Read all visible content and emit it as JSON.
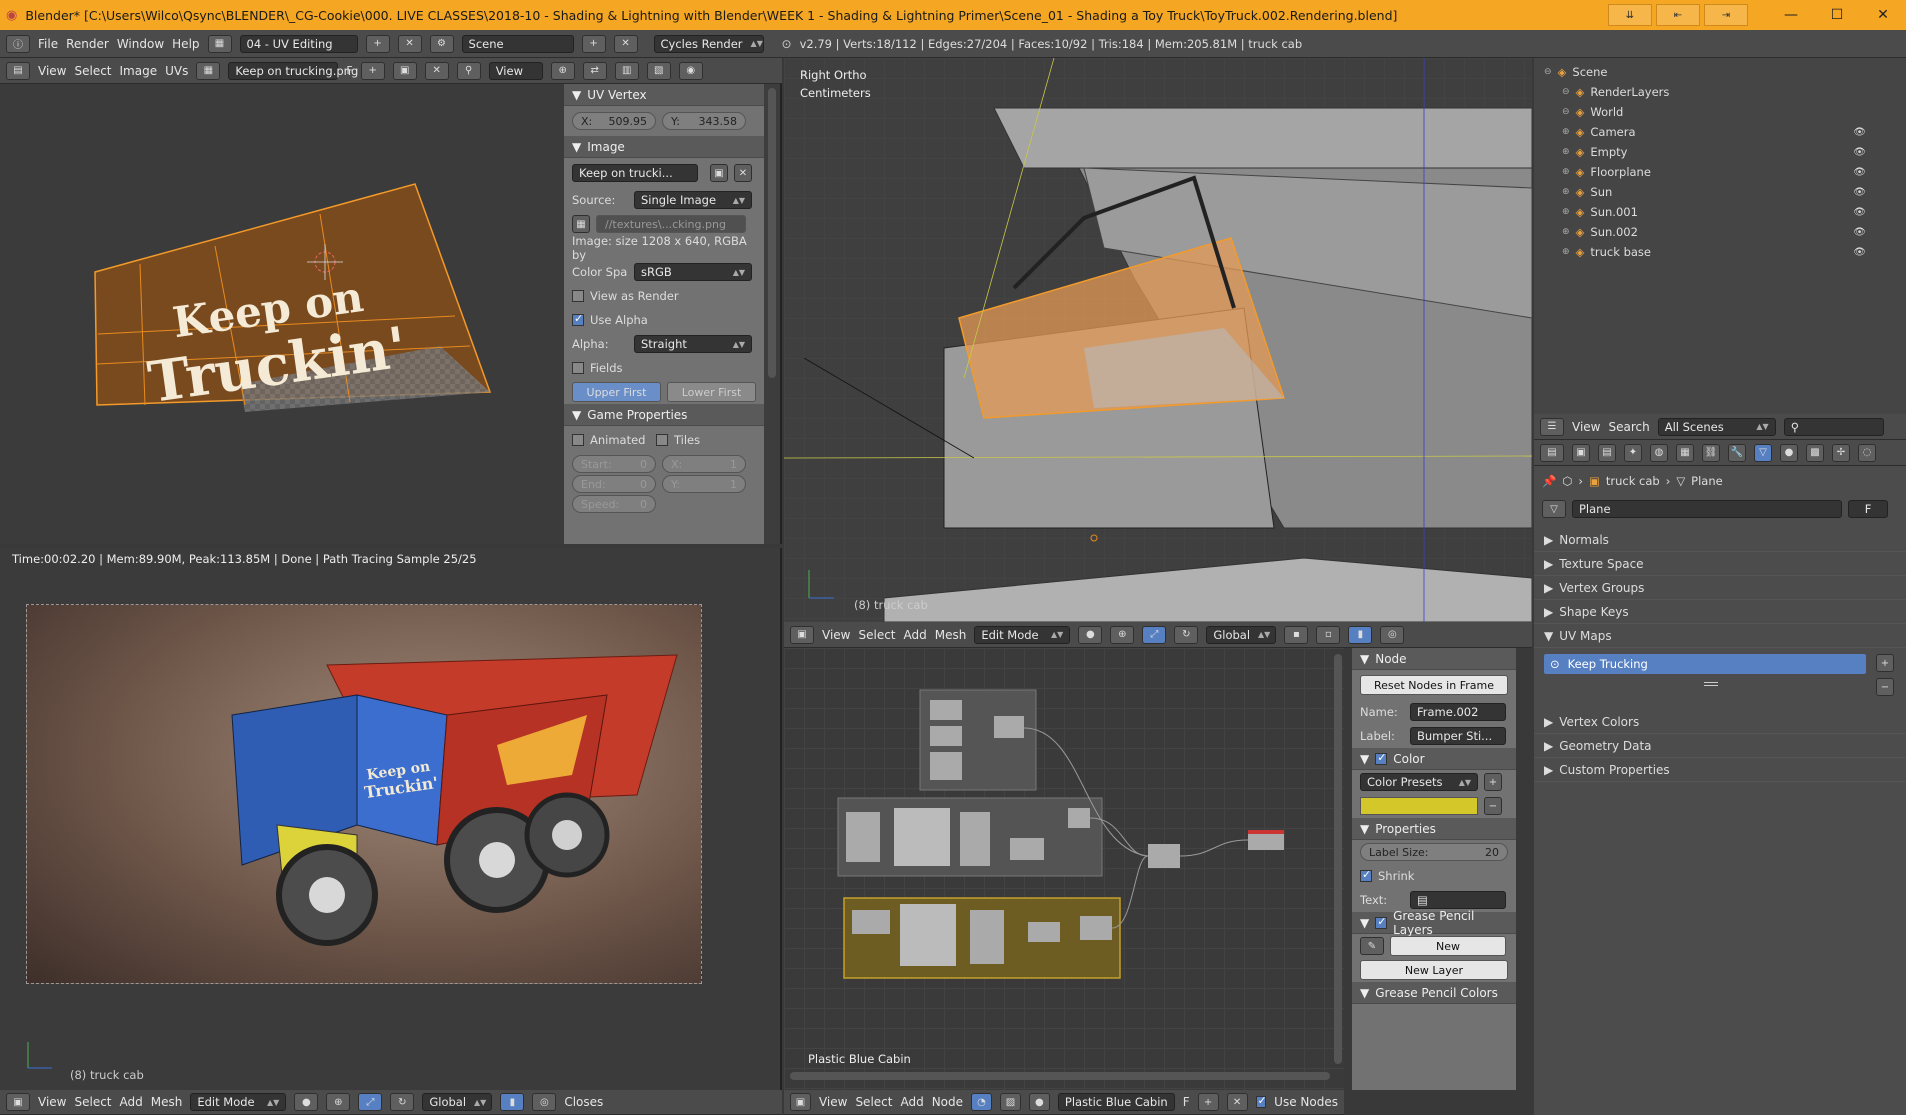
{
  "window": {
    "title": "Blender* [C:\\Users\\Wilco\\Qsync\\BLENDER\\_CG-Cookie\\000. LIVE CLASSES\\2018-10 - Shading & Lightning with Blender\\WEEK 1 - Shading & Lightning Primer\\Scene_01 - Shading a Toy Truck\\ToyTruck.002.Rendering.blend]"
  },
  "info": {
    "menus": [
      "File",
      "Render",
      "Window",
      "Help"
    ],
    "layout": "04 - UV Editing",
    "scene": "Scene",
    "engine": "Cycles Render",
    "stats": "v2.79 | Verts:18/112 | Edges:27/204 | Faces:10/92 | Tris:184 | Mem:205.81M | truck cab"
  },
  "uv_editor": {
    "menus": [
      "View",
      "Select",
      "Image",
      "UVs"
    ],
    "image_name": "Keep on trucking.png",
    "f_label": "F",
    "view_label": "View",
    "artwork_line1": "Keep on",
    "artwork_line2": "Truckin'"
  },
  "uv_panel": {
    "uv_vertex": "UV Vertex",
    "x_label": "X:",
    "x_value": "509.95",
    "y_label": "Y:",
    "y_value": "343.58",
    "image_section": "Image",
    "image_field": "Keep on trucki...",
    "source_label": "Source:",
    "source_value": "Single Image",
    "filepath": "//textures\\...cking.png",
    "image_size": "Image: size 1208 x 640, RGBA by",
    "color_space_label": "Color Spa",
    "color_space_value": "sRGB",
    "view_as_render": "View as Render",
    "use_alpha": "Use Alpha",
    "alpha_label": "Alpha:",
    "alpha_value": "Straight",
    "fields": "Fields",
    "upper_first": "Upper First",
    "lower_first": "Lower First",
    "game_props": "Game Properties",
    "animated": "Animated",
    "tiles": "Tiles",
    "start_label": "Start:",
    "start_value": "0",
    "end_label": "End:",
    "end_value": "0",
    "speed_label": "Speed:",
    "speed_value": "0",
    "tx_label": "X:",
    "tx_value": "1",
    "ty_label": "Y:",
    "ty_value": "1"
  },
  "viewport": {
    "view_name": "Right Ortho",
    "units": "Centimeters",
    "object_label": "(8) truck cab",
    "menus": [
      "View",
      "Select",
      "Add",
      "Mesh"
    ],
    "mode": "Edit Mode",
    "orientation": "Global"
  },
  "render": {
    "status": "Time:00:02.20 | Mem:89.90M, Peak:113.85M | Done | Path Tracing Sample 25/25",
    "object_label": "(8) truck cab",
    "menus": [
      "View",
      "Select",
      "Add",
      "Mesh"
    ],
    "mode": "Edit Mode",
    "orientation": "Global",
    "closest": "Closes"
  },
  "node_editor": {
    "frame_label": "Plastic Blue Cabin",
    "menus": [
      "View",
      "Select",
      "Add",
      "Node"
    ],
    "material": "Plastic Blue Cabin",
    "f_label": "F",
    "use_nodes": "Use Nodes"
  },
  "node_panel": {
    "node_section": "Node",
    "reset_nodes": "Reset Nodes in Frame",
    "name_label": "Name:",
    "name_value": "Frame.002",
    "label_label": "Label:",
    "label_value": "Bumper Sti...",
    "color_section": "Color",
    "color_presets": "Color Presets",
    "properties_section": "Properties",
    "label_size_label": "Label Size:",
    "label_size_value": "20",
    "shrink": "Shrink",
    "text_label": "Text:",
    "grease_layers": "Grease Pencil Layers",
    "new_btn": "New",
    "new_layer_btn": "New Layer",
    "grease_colors": "Grease Pencil Colors"
  },
  "outliner": {
    "items": [
      {
        "name": "Scene",
        "indent": 0
      },
      {
        "name": "RenderLayers",
        "indent": 1
      },
      {
        "name": "World",
        "indent": 1
      },
      {
        "name": "Camera",
        "indent": 1
      },
      {
        "name": "Empty",
        "indent": 1
      },
      {
        "name": "Floorplane",
        "indent": 1
      },
      {
        "name": "Sun",
        "indent": 1
      },
      {
        "name": "Sun.001",
        "indent": 1
      },
      {
        "name": "Sun.002",
        "indent": 1
      },
      {
        "name": "truck base",
        "indent": 1
      }
    ],
    "menus": [
      "View",
      "Search"
    ],
    "filter": "All Scenes"
  },
  "properties": {
    "breadcrumb_obj": "truck cab",
    "breadcrumb_mesh": "Plane",
    "mesh_name": "Plane",
    "f_label": "F",
    "sections_top": [
      "Normals",
      "Texture Space",
      "Vertex Groups",
      "Shape Keys"
    ],
    "uv_maps": "UV Maps",
    "uv_map_item": "Keep Trucking",
    "sections_bottom": [
      "Vertex Colors",
      "Geometry Data",
      "Custom Properties"
    ]
  },
  "colors": {
    "accent_orange": "#f5a623",
    "selection_blue": "#5680c2",
    "uv_brown": "#7a4a1f",
    "sticker_yellow": "#d4c72a"
  }
}
